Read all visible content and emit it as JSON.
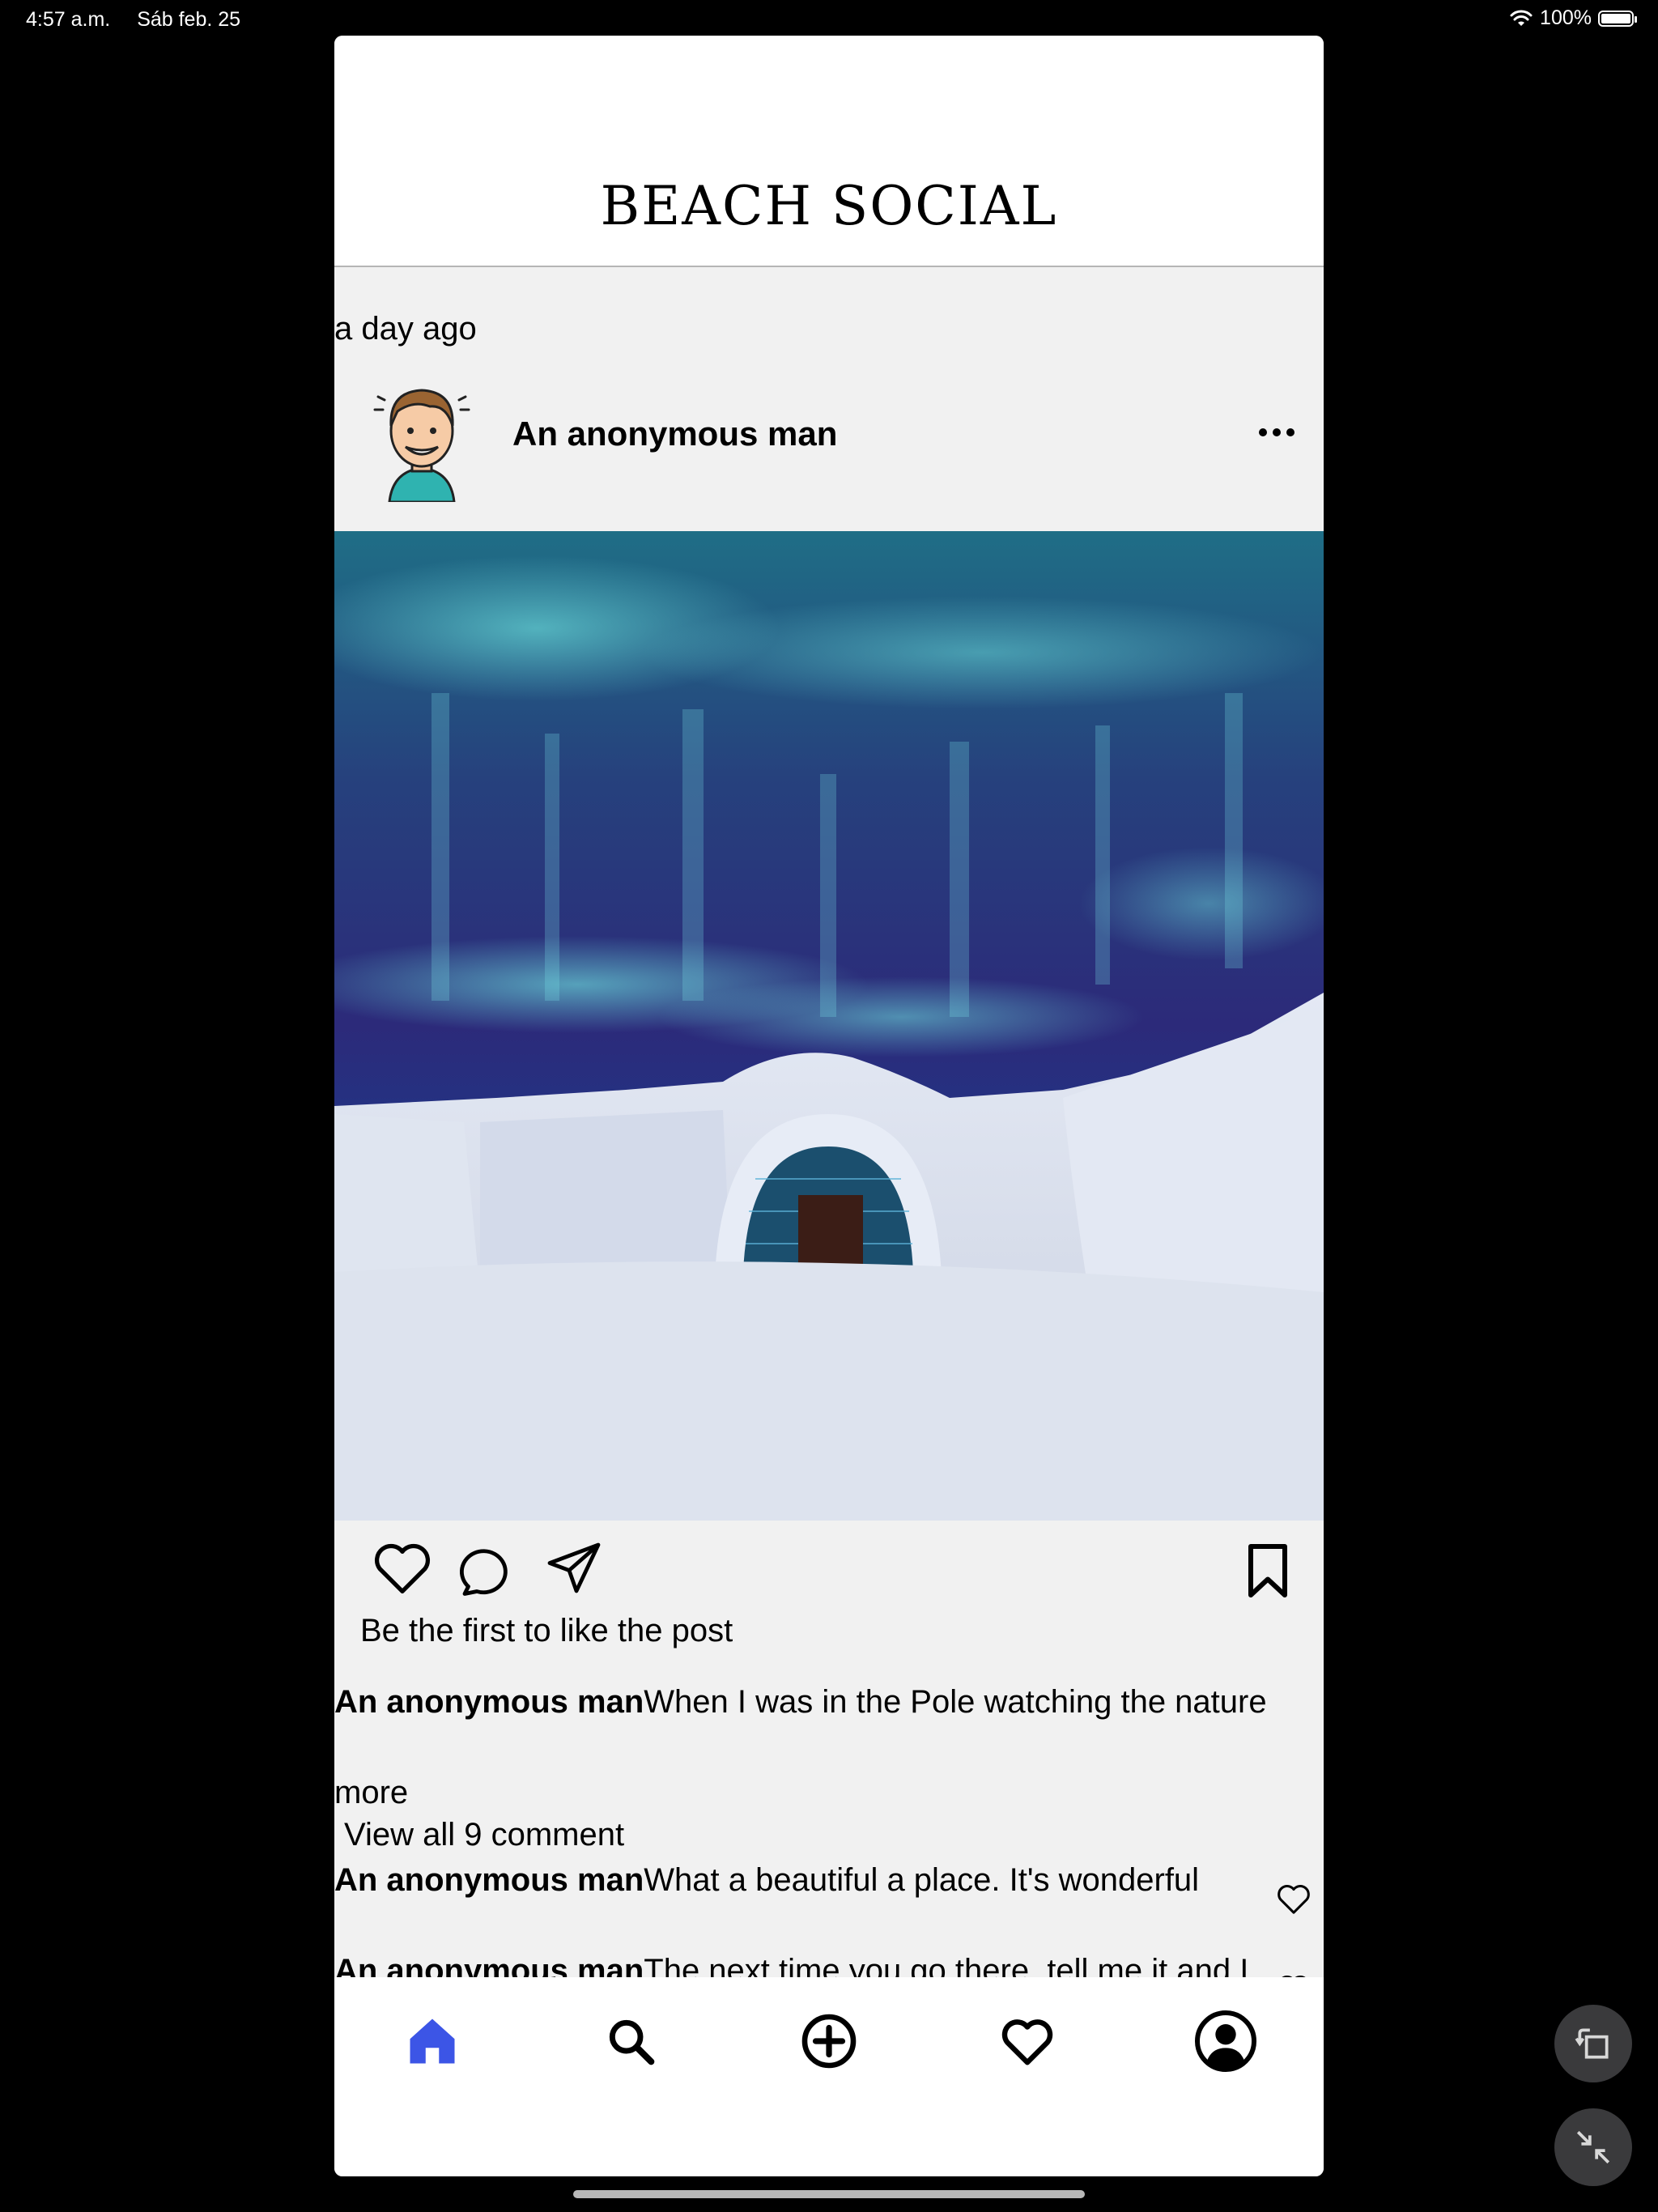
{
  "status_bar": {
    "time": "4:57 a.m.",
    "date": "Sáb feb. 25",
    "battery": "100%",
    "battery_level": 1.0
  },
  "app": {
    "title": "BEACH SOCIAL"
  },
  "post": {
    "timestamp": "a day ago",
    "author": "An anonymous man",
    "likes_text": "Be the first to like the post",
    "caption_author": "An anonymous man",
    "caption_text": "When I was in the Pole watching the nature",
    "more_label": "more",
    "view_all_label": " View all 9 comment",
    "comments": [
      {
        "author": "An anonymous man",
        "text": "What a beautiful a place. It's wonderful"
      },
      {
        "author": "An anonymous man",
        "text": "The next time you go there, tell me it and I will go with you !!"
      }
    ]
  },
  "colors": {
    "active_tab": "#3c55e6",
    "background": "#f1f1f1"
  },
  "icons": {
    "tabs": [
      "home-icon",
      "search-icon",
      "add-icon",
      "heart-icon",
      "profile-icon"
    ],
    "actions": [
      "like-icon",
      "comment-icon",
      "share-icon",
      "bookmark-icon"
    ]
  }
}
